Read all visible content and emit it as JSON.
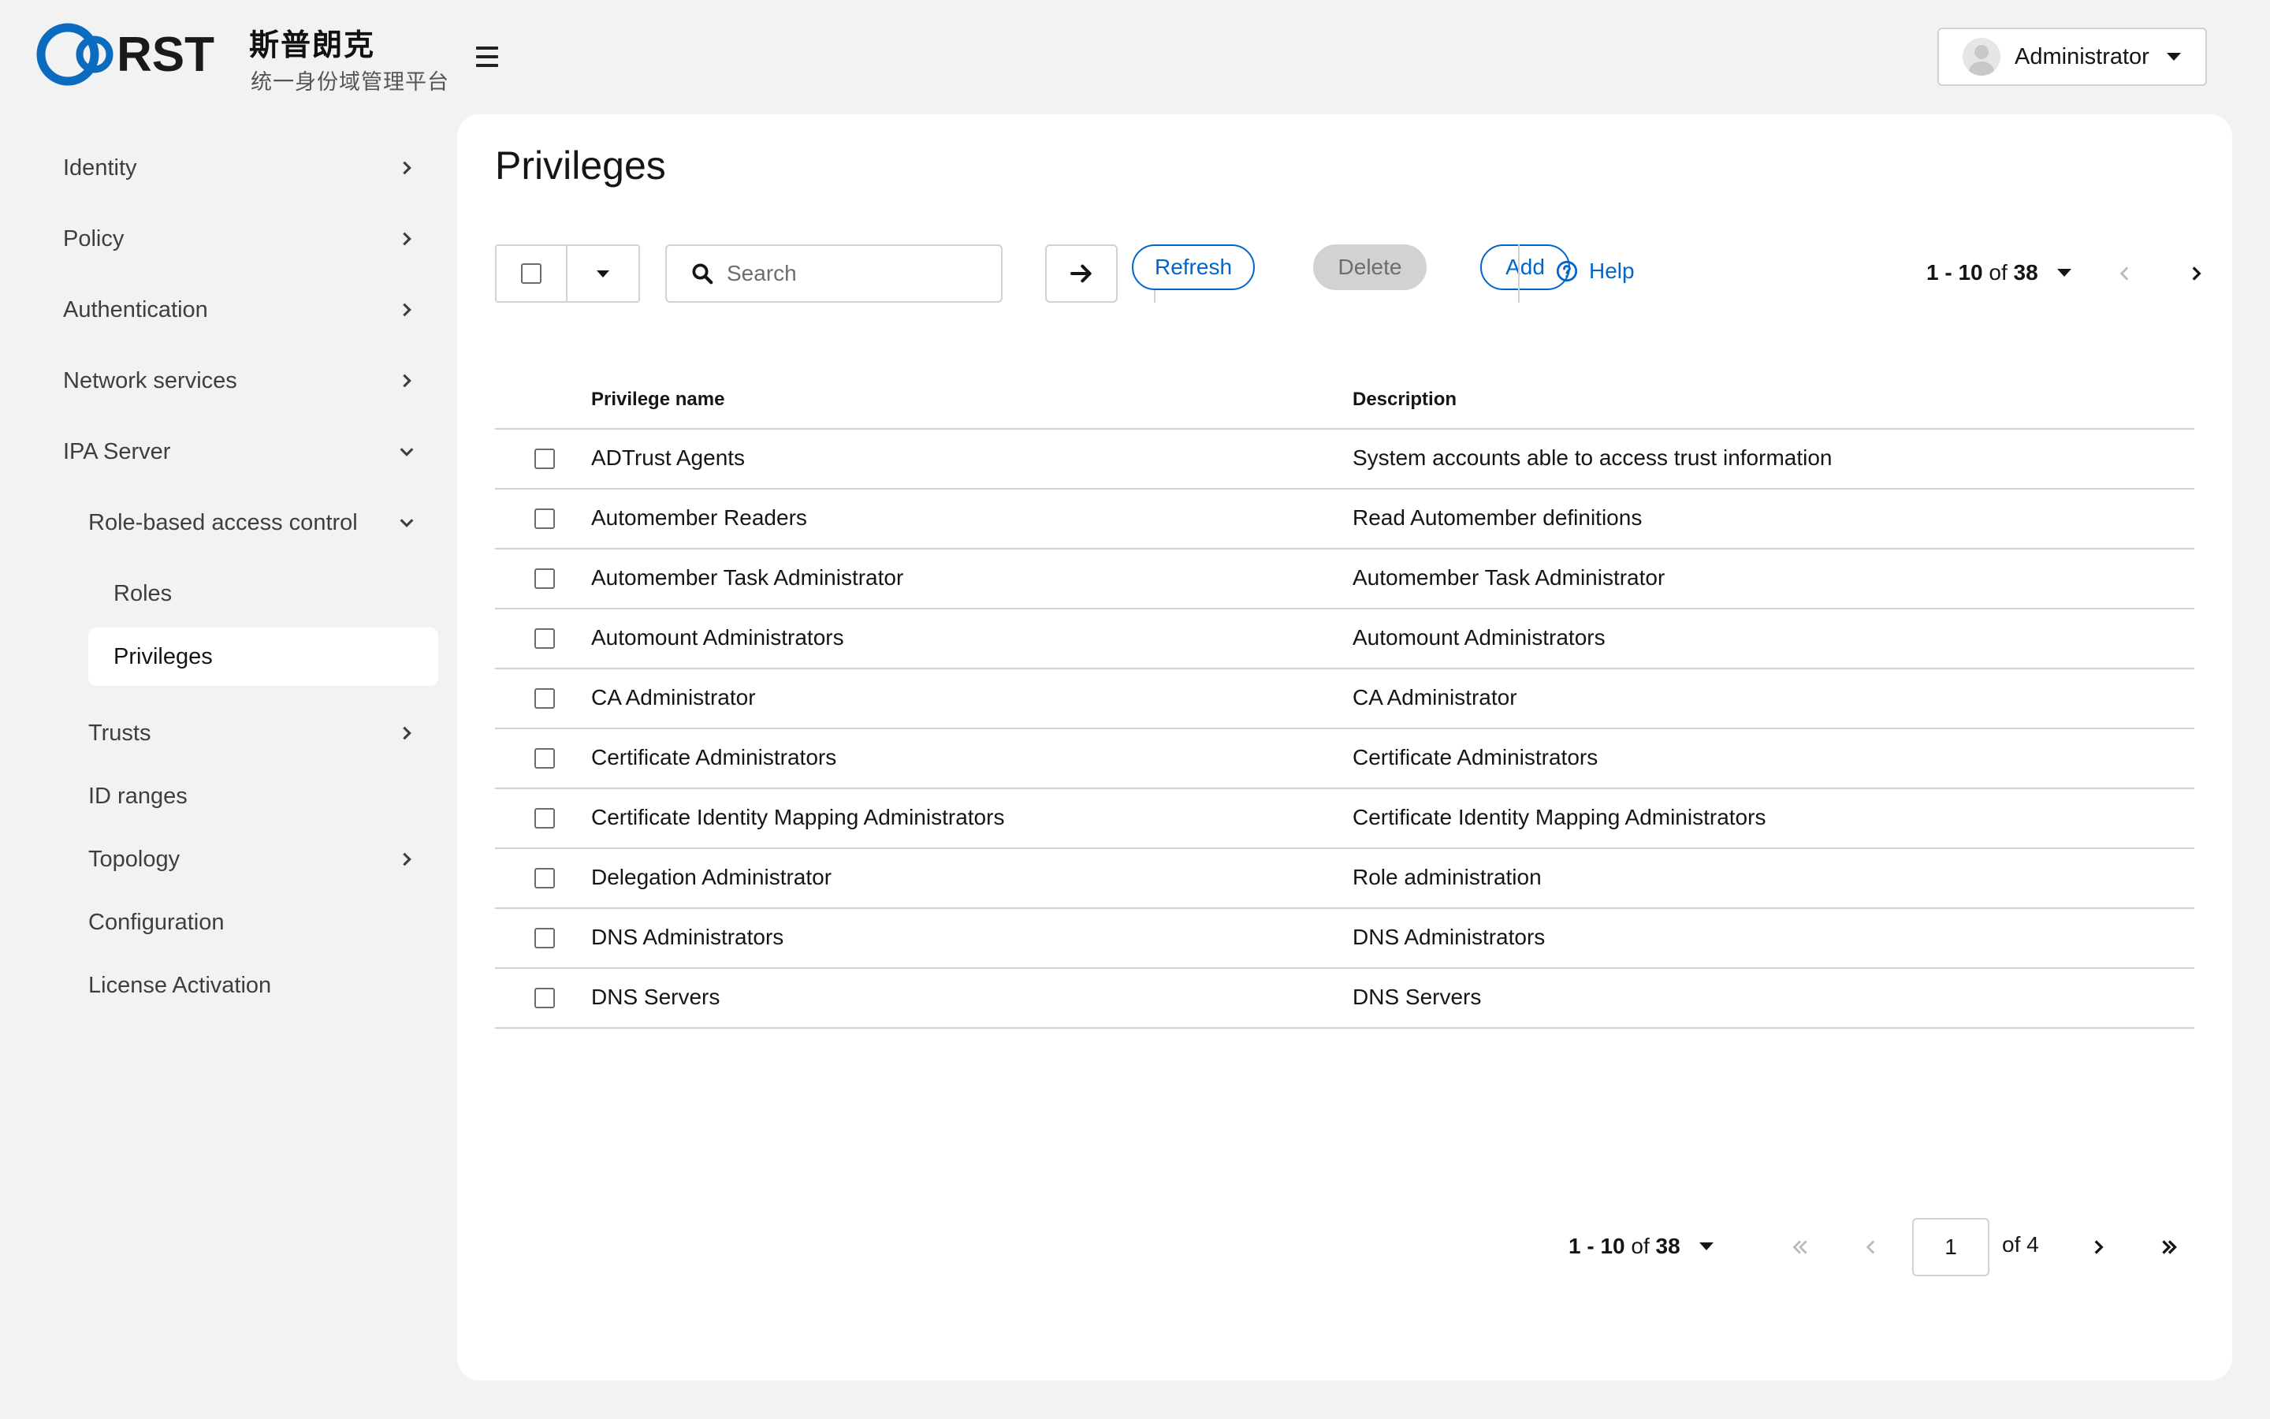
{
  "brand": {
    "logo_text": "RST",
    "name_cn": "斯普朗克",
    "subtitle_cn": "统一身份域管理平台",
    "accent_color": "#0a6bbf"
  },
  "header": {
    "menu_icon": "hamburger-icon",
    "user_name": "Administrator"
  },
  "sidebar": {
    "items": [
      {
        "label": "Identity",
        "expanded": false
      },
      {
        "label": "Policy",
        "expanded": false
      },
      {
        "label": "Authentication",
        "expanded": false
      },
      {
        "label": "Network services",
        "expanded": false
      },
      {
        "label": "IPA Server",
        "expanded": true
      },
      {
        "label": "Role-based access control",
        "expanded": true
      },
      {
        "label": "Roles"
      },
      {
        "label": "Privileges",
        "active": true
      },
      {
        "label": "Trusts",
        "expanded": false
      },
      {
        "label": "ID ranges"
      },
      {
        "label": "Topology",
        "expanded": false
      },
      {
        "label": "Configuration"
      },
      {
        "label": "License Activation"
      }
    ]
  },
  "main": {
    "title": "Privileges",
    "search_placeholder": "Search",
    "buttons": {
      "refresh": "Refresh",
      "delete": "Delete",
      "add": "Add",
      "help": "Help"
    },
    "pagination": {
      "range": "1 - 10",
      "of_label": "of",
      "total": "38",
      "current_page": "1",
      "of_pages": "of 4"
    },
    "columns": [
      "Privilege name",
      "Description"
    ],
    "rows": [
      {
        "name": "ADTrust Agents",
        "description": "System accounts able to access trust information"
      },
      {
        "name": "Automember Readers",
        "description": "Read Automember definitions"
      },
      {
        "name": "Automember Task Administrator",
        "description": "Automember Task Administrator"
      },
      {
        "name": "Automount Administrators",
        "description": "Automount Administrators"
      },
      {
        "name": "CA Administrator",
        "description": "CA Administrator"
      },
      {
        "name": "Certificate Administrators",
        "description": "Certificate Administrators"
      },
      {
        "name": "Certificate Identity Mapping Administrators",
        "description": "Certificate Identity Mapping Administrators"
      },
      {
        "name": "Delegation Administrator",
        "description": "Role administration"
      },
      {
        "name": "DNS Administrators",
        "description": "DNS Administrators"
      },
      {
        "name": "DNS Servers",
        "description": "DNS Servers"
      }
    ]
  }
}
